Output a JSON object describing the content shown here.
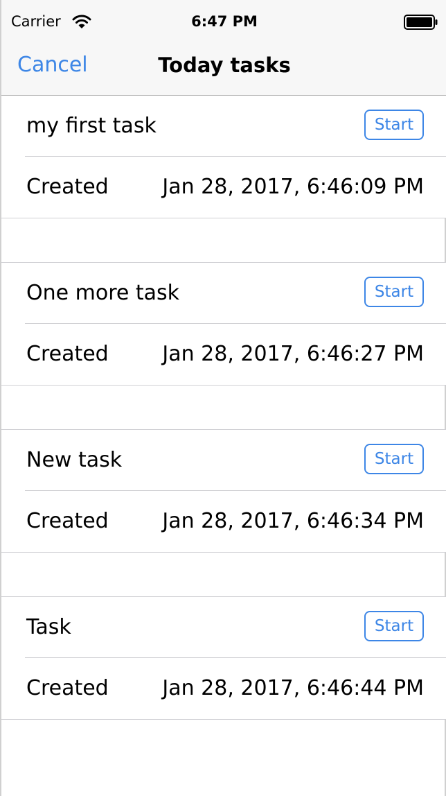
{
  "status_bar": {
    "carrier": "Carrier",
    "time": "6:47 PM",
    "wifi_icon": "wifi-icon",
    "battery_icon": "battery-full-icon"
  },
  "nav_bar": {
    "cancel_label": "Cancel",
    "title": "Today tasks"
  },
  "colors": {
    "accent": "#3d86e6",
    "separator": "#cfcfd3",
    "bar_background": "#f7f7f7"
  },
  "tasks": [
    {
      "name": "my first task",
      "button_label": "Start",
      "created_label": "Created",
      "created_value": "Jan 28, 2017, 6:46:09 PM"
    },
    {
      "name": "One more task",
      "button_label": "Start",
      "created_label": "Created",
      "created_value": "Jan 28, 2017, 6:46:27 PM"
    },
    {
      "name": "New task",
      "button_label": "Start",
      "created_label": "Created",
      "created_value": "Jan 28, 2017, 6:46:34 PM"
    },
    {
      "name": "Task",
      "button_label": "Start",
      "created_label": "Created",
      "created_value": "Jan 28, 2017, 6:46:44 PM"
    }
  ]
}
